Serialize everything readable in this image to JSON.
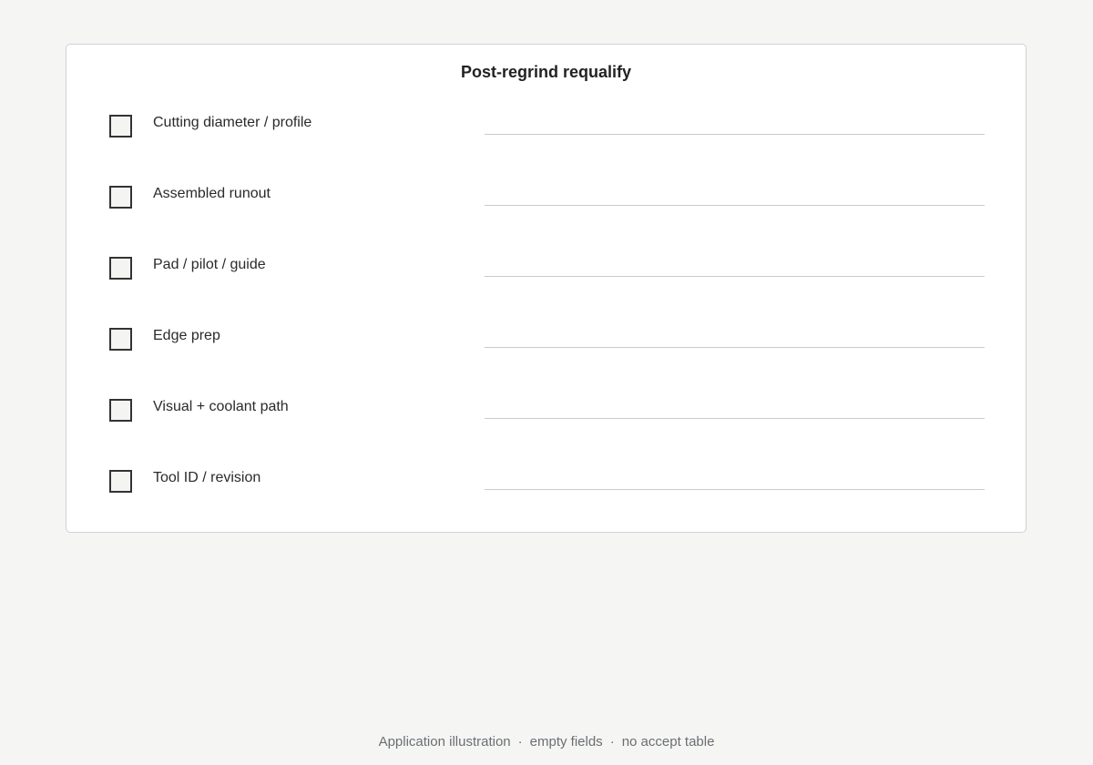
{
  "form": {
    "title": "Post-regrind requalify",
    "rows": [
      {
        "label": "Cutting diameter / profile",
        "value": ""
      },
      {
        "label": "Assembled runout",
        "value": ""
      },
      {
        "label": "Pad / pilot / guide",
        "value": ""
      },
      {
        "label": "Edge prep",
        "value": ""
      },
      {
        "label": "Visual + coolant path",
        "value": ""
      },
      {
        "label": "Tool ID / revision",
        "value": ""
      }
    ]
  },
  "footer": {
    "items": [
      "Application illustration",
      "empty fields",
      "no accept table"
    ],
    "separator": "·"
  },
  "colors": {
    "background": "#f5f6f4",
    "card": "#ffffff",
    "checkbox_border": "#333333",
    "field_line": "#c8cacc",
    "footer_text": "#6b6e72"
  }
}
